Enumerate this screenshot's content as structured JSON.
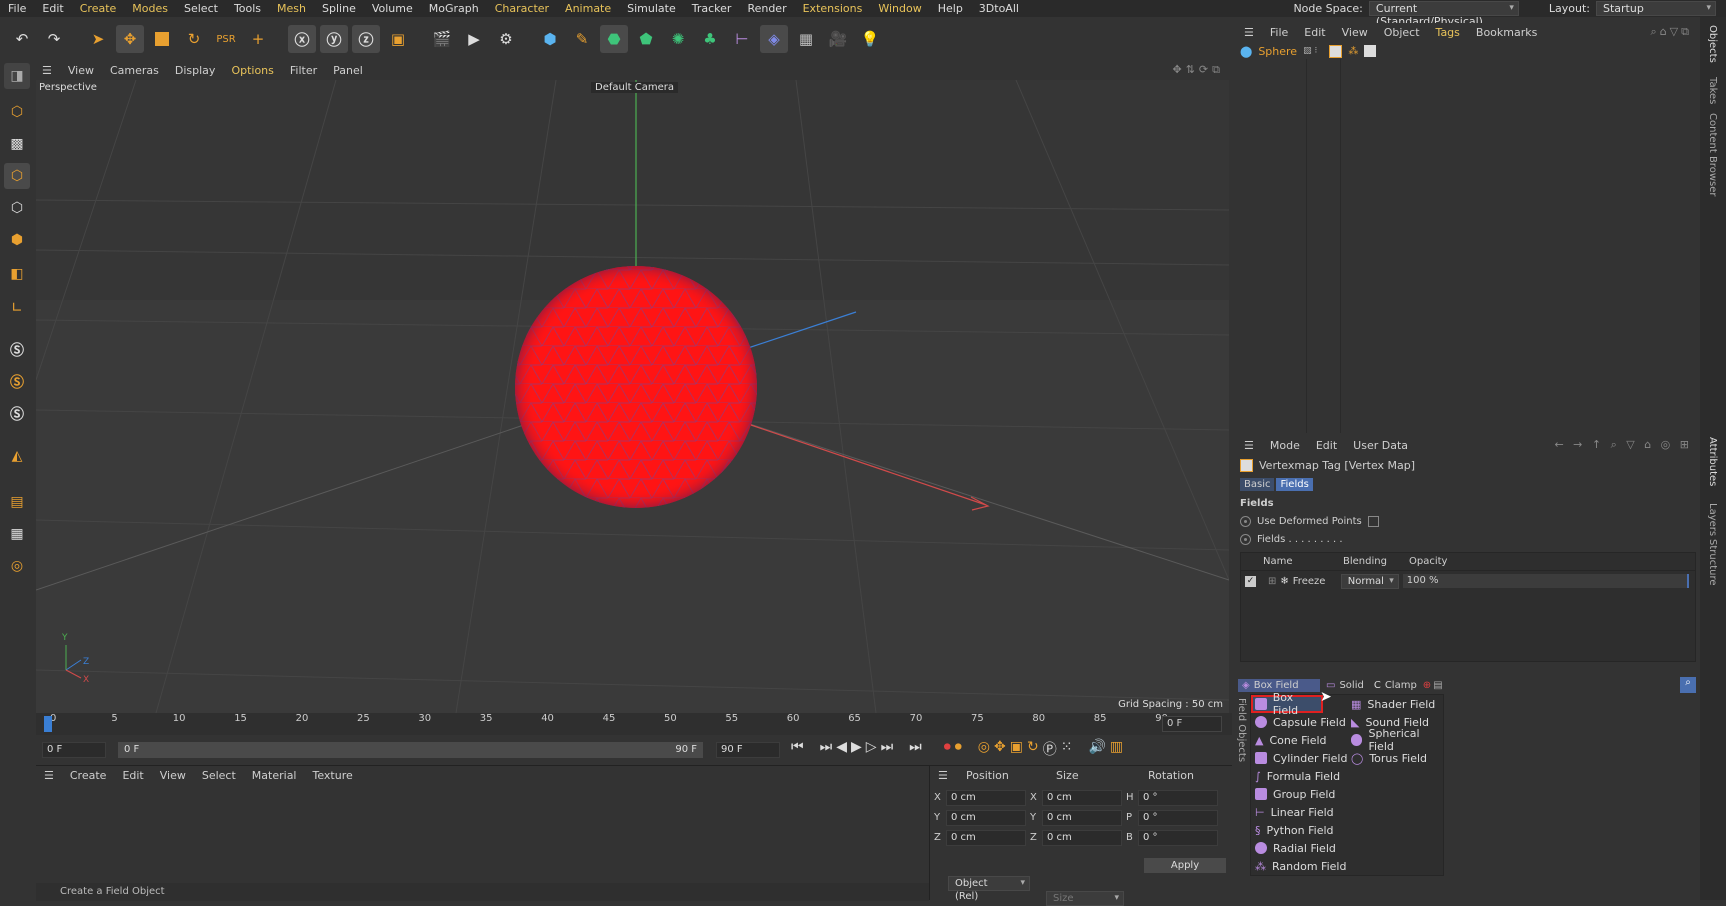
{
  "menubar": {
    "items": [
      "File",
      "Edit",
      "Create",
      "Modes",
      "Select",
      "Tools",
      "Mesh",
      "Spline",
      "Volume",
      "MoGraph",
      "Character",
      "Animate",
      "Simulate",
      "Tracker",
      "Render",
      "Extensions",
      "Window",
      "Help",
      "3DtoAll"
    ],
    "node_space_label": "Node Space:",
    "node_space_value": "Current (Standard/Physical)",
    "layout_label": "Layout:",
    "layout_value": "Startup"
  },
  "viewport_menu": [
    "View",
    "Cameras",
    "Display",
    "Options",
    "Filter",
    "Panel"
  ],
  "viewport": {
    "view_name": "Perspective",
    "camera": "Default Camera",
    "grid_spacing": "Grid Spacing : 50 cm",
    "sphere_color": "#ff1414"
  },
  "timeline": {
    "ticks": [
      "0",
      "5",
      "10",
      "15",
      "20",
      "25",
      "30",
      "35",
      "40",
      "45",
      "50",
      "55",
      "60",
      "65",
      "70",
      "75",
      "80",
      "85",
      "90"
    ],
    "current_frame": "0 F",
    "start": "0 F",
    "range_start": "0 F",
    "range_end": "90 F",
    "end": "90 F"
  },
  "material_menu": [
    "Create",
    "Edit",
    "View",
    "Select",
    "Material",
    "Texture"
  ],
  "coords": {
    "headers": [
      "Position",
      "Size",
      "Rotation"
    ],
    "rows": [
      {
        "axis": "X",
        "pos": "0 cm",
        "saxis": "X",
        "size": "0 cm",
        "raxis": "H",
        "rot": "0 °"
      },
      {
        "axis": "Y",
        "pos": "0 cm",
        "saxis": "Y",
        "size": "0 cm",
        "raxis": "P",
        "rot": "0 °"
      },
      {
        "axis": "Z",
        "pos": "0 cm",
        "saxis": "Z",
        "size": "0 cm",
        "raxis": "B",
        "rot": "0 °"
      }
    ],
    "mode": "Object (Rel)",
    "size_mode": "Size",
    "apply": "Apply"
  },
  "object_manager": {
    "menu": [
      "File",
      "Edit",
      "View",
      "Object",
      "Tags",
      "Bookmarks"
    ],
    "object_name": "Sphere"
  },
  "attribute_manager": {
    "menu": [
      "Mode",
      "Edit",
      "User Data"
    ],
    "title": "Vertexmap Tag [Vertex Map]",
    "tabs": [
      "Basic",
      "Fields"
    ],
    "section": "Fields",
    "use_deformed_points": "Use Deformed Points",
    "fields_label": "Fields . . . . . . . . .",
    "columns": [
      "Name",
      "Blending",
      "Opacity"
    ],
    "row": {
      "name": "Freeze",
      "blending": "Normal",
      "opacity": "100 %"
    },
    "bottom_buttons": [
      "Box Field",
      "Solid",
      "Clamp"
    ],
    "field_objects_label": "Field Objects",
    "menu_left": [
      "Box Field",
      "Capsule Field",
      "Cone Field",
      "Cylinder Field",
      "Formula Field",
      "Group Field",
      "Linear Field",
      "Python Field",
      "Radial Field",
      "Random Field"
    ],
    "menu_right": [
      "Shader Field",
      "Sound Field",
      "Spherical Field",
      "Torus Field"
    ]
  },
  "right_strip": [
    "Objects",
    "Takes",
    "Content Browser",
    "Attributes",
    "Layers",
    "Structure"
  ],
  "status": "Create a Field Object"
}
